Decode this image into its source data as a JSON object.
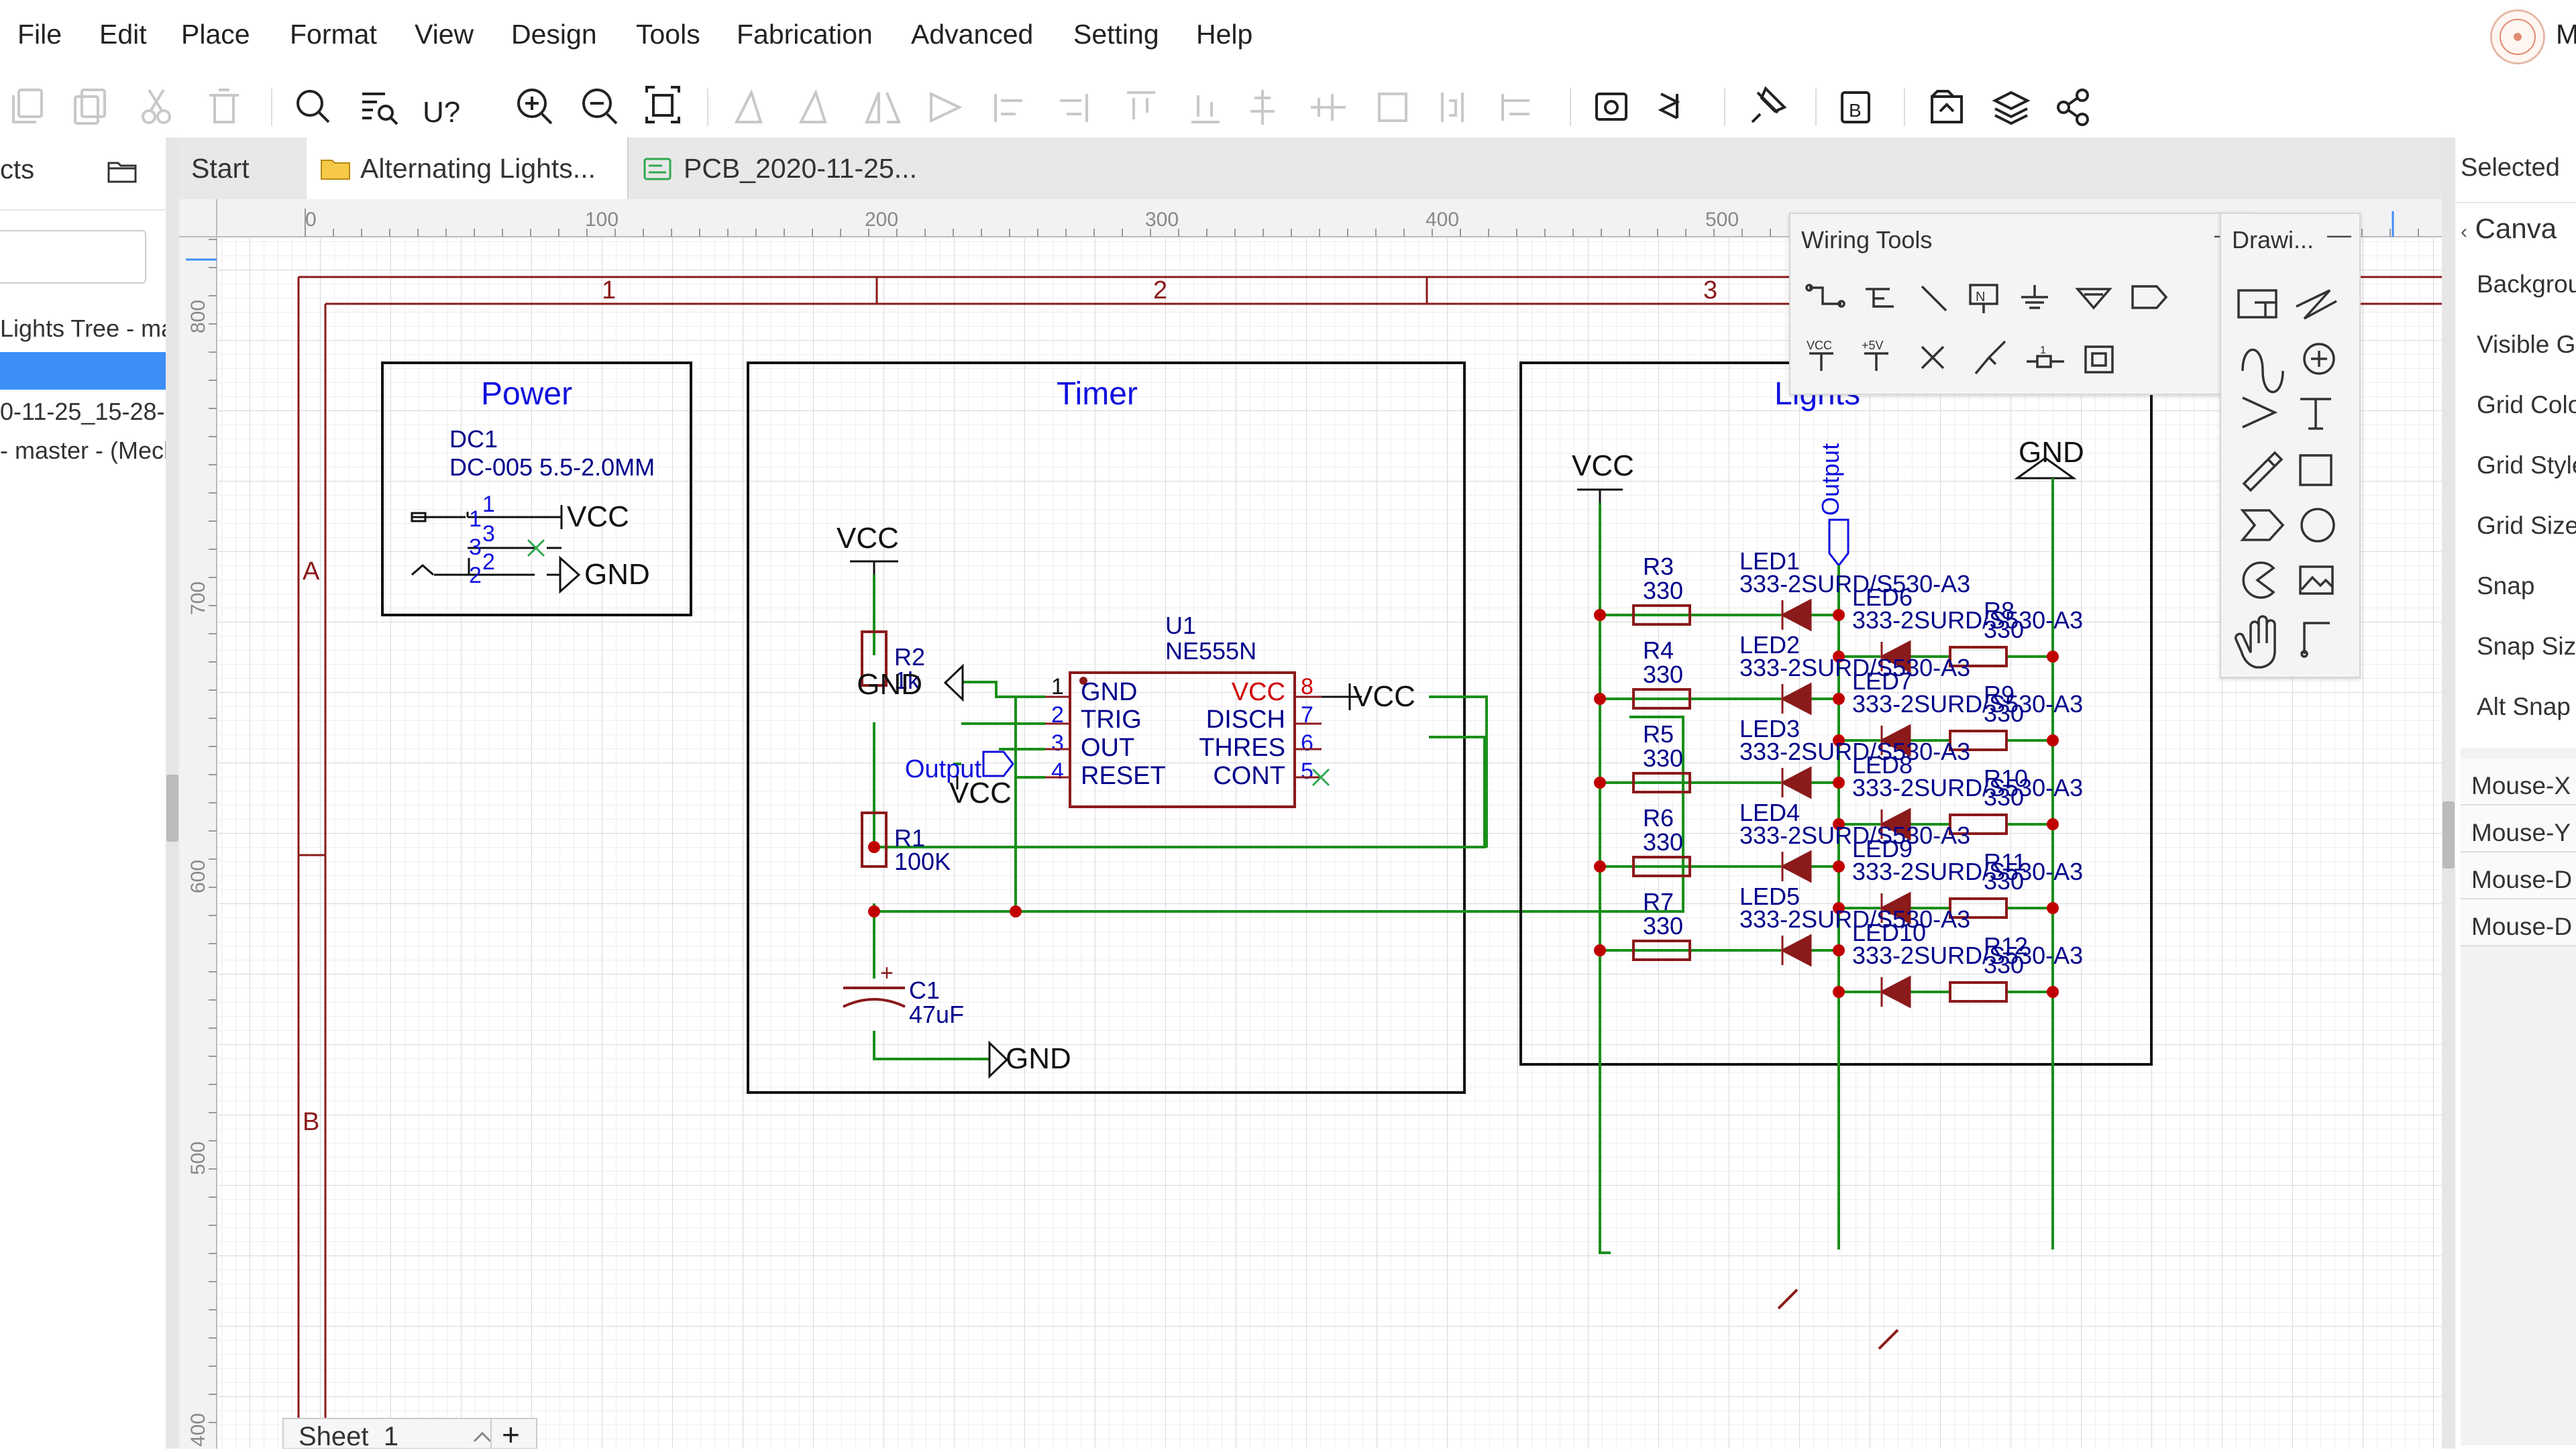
{
  "menu": [
    "File",
    "Edit",
    "Place",
    "Format",
    "View",
    "Design",
    "Tools",
    "Fabrication",
    "Advanced",
    "Setting",
    "Help"
  ],
  "user_initial": "M",
  "left_panel": {
    "title": "cts",
    "items": [
      "Lights Tree - ma",
      "",
      "0-11-25_15-28-",
      "- master - (Mech"
    ]
  },
  "tabs": [
    {
      "label": "Start"
    },
    {
      "label": "Alternating Lights..."
    },
    {
      "label": "PCB_2020-11-25..."
    }
  ],
  "ruler": {
    "top": [
      "0",
      "100",
      "200",
      "300",
      "400",
      "500"
    ],
    "left": [
      "800",
      "700",
      "600",
      "500",
      "400"
    ]
  },
  "sheet": {
    "zones_top": [
      "1",
      "2",
      "3"
    ],
    "zones_left": [
      "A",
      "B"
    ],
    "tab_label": "Sheet_1",
    "add_label": "+"
  },
  "schematic": {
    "power": {
      "title": "Power",
      "ref": "DC1",
      "value": "DC-005 5.5-2.0MM",
      "pins": [
        "1",
        "1",
        "3",
        "3",
        "2",
        "2"
      ],
      "net_vcc": "VCC",
      "net_gnd": "GND"
    },
    "timer": {
      "title": "Timer",
      "vcc": "VCC",
      "gnd": "GND",
      "gnd2": "GND",
      "vcc_right": "VCC",
      "vcc_reset": "VCC",
      "output_label": "Output",
      "ic_ref": "U1",
      "ic_value": "NE555N",
      "ic_left_pins": [
        "GND",
        "TRIG",
        "OUT",
        "RESET"
      ],
      "ic_left_nums": [
        "1",
        "2",
        "3",
        "4"
      ],
      "ic_right_pins": [
        "VCC",
        "DISCH",
        "THRES",
        "CONT"
      ],
      "ic_right_nums": [
        "8",
        "7",
        "6",
        "5"
      ],
      "r2_ref": "R2",
      "r2_val": "1k",
      "r1_ref": "R1",
      "r1_val": "100K",
      "c1_ref": "C1",
      "c1_val": "47uF",
      "c1_plus": "+"
    },
    "lights": {
      "title": "Lights",
      "vcc": "VCC",
      "gnd": "GND",
      "output": "Output",
      "left_resistors": [
        {
          "ref": "R3",
          "val": "330"
        },
        {
          "ref": "R4",
          "val": "330"
        },
        {
          "ref": "R5",
          "val": "330"
        },
        {
          "ref": "R6",
          "val": "330"
        },
        {
          "ref": "R7",
          "val": "330"
        }
      ],
      "right_resistors": [
        {
          "ref": "R8",
          "val": "330"
        },
        {
          "ref": "R9",
          "val": "330"
        },
        {
          "ref": "R10",
          "val": "330"
        },
        {
          "ref": "R11",
          "val": "330"
        },
        {
          "ref": "R12",
          "val": "330"
        }
      ],
      "leds_left": [
        "LED1",
        "LED2",
        "LED3",
        "LED4",
        "LED5"
      ],
      "leds_right": [
        "LED6",
        "LED7",
        "LED8",
        "LED9",
        "LED10"
      ],
      "led_value": "333-2SURD/S530-A3"
    }
  },
  "wiring_tools": {
    "title": "Wiring Tools",
    "minimize": "—",
    "vcc_label": "VCC",
    "v5_label": "+5V"
  },
  "drawing_tools": {
    "title": "Drawi...",
    "minimize": "—"
  },
  "right_panel": {
    "header": "Selected",
    "section": "Canva",
    "props": [
      "Backgrou",
      "Visible G",
      "Grid Colo",
      "Grid Style",
      "Grid Size",
      "Snap",
      "Snap Size",
      "Alt Snap"
    ],
    "mouse": [
      "Mouse-X",
      "Mouse-Y",
      "Mouse-D",
      "Mouse-D"
    ]
  }
}
